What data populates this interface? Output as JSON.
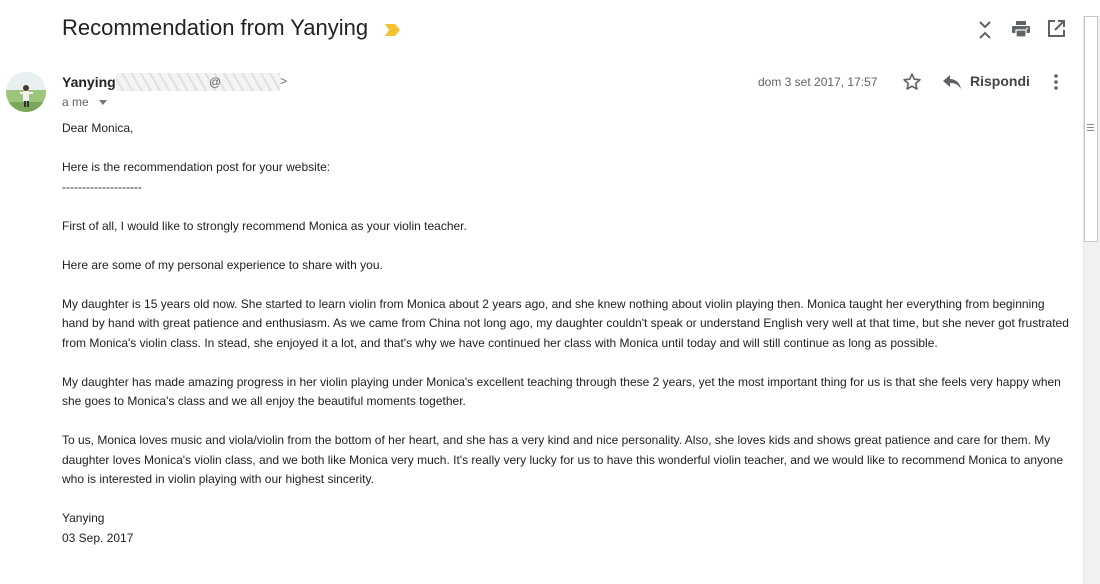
{
  "header": {
    "subject": "Recommendation from Yanying",
    "icons": {
      "label_marker": "importance-marker-icon",
      "collapse": "collapse-all-icon",
      "print": "print-icon",
      "open_new_window": "open-in-new-window-icon"
    },
    "colors": {
      "importance_marker": "#f4c430"
    }
  },
  "message": {
    "sender_name": "Yanying",
    "email_at": "@",
    "email_close": ">",
    "to_line": "a me",
    "date": "dom 3 set 2017, 17:57",
    "reply_label": "Rispondi"
  },
  "body": {
    "greeting": "Dear Monica,",
    "intro": "Here is the recommendation post for your website:",
    "divider": "--------------------",
    "p1": "First of all, I would like to strongly recommend Monica as your violin teacher.",
    "p2": "Here are some of my personal experience to share with you.",
    "p3": "My daughter is 15 years old now. She started to learn violin from Monica about 2 years ago, and she knew nothing about violin playing then. Monica taught her everything from beginning hand by hand with great patience and enthusiasm. As we came from China not long ago, my daughter couldn't speak or understand English very well at that time, but she never got frustrated from Monica's violin class. In stead, she enjoyed it a lot, and that's why we have continued her class with Monica until today and will still continue as long as possible.",
    "p4": "My daughter has made amazing progress in her violin playing under Monica's excellent teaching through these 2 years, yet the most important thing for us is that she feels very happy when she goes to Monica's class and we all enjoy the beautiful moments together.",
    "p5": "To us, Monica loves music and viola/violin from the bottom of her heart, and she has a very kind and nice personality. Also, she loves kids and shows great patience and care for them. My daughter loves Monica's violin class, and we both like Monica very much. It's really very lucky for us to have this wonderful violin teacher, and we would like to recommend Monica to anyone who is interested in violin playing with our highest sincerity.",
    "signature_name": "Yanying",
    "signature_date": "03 Sep. 2017"
  }
}
